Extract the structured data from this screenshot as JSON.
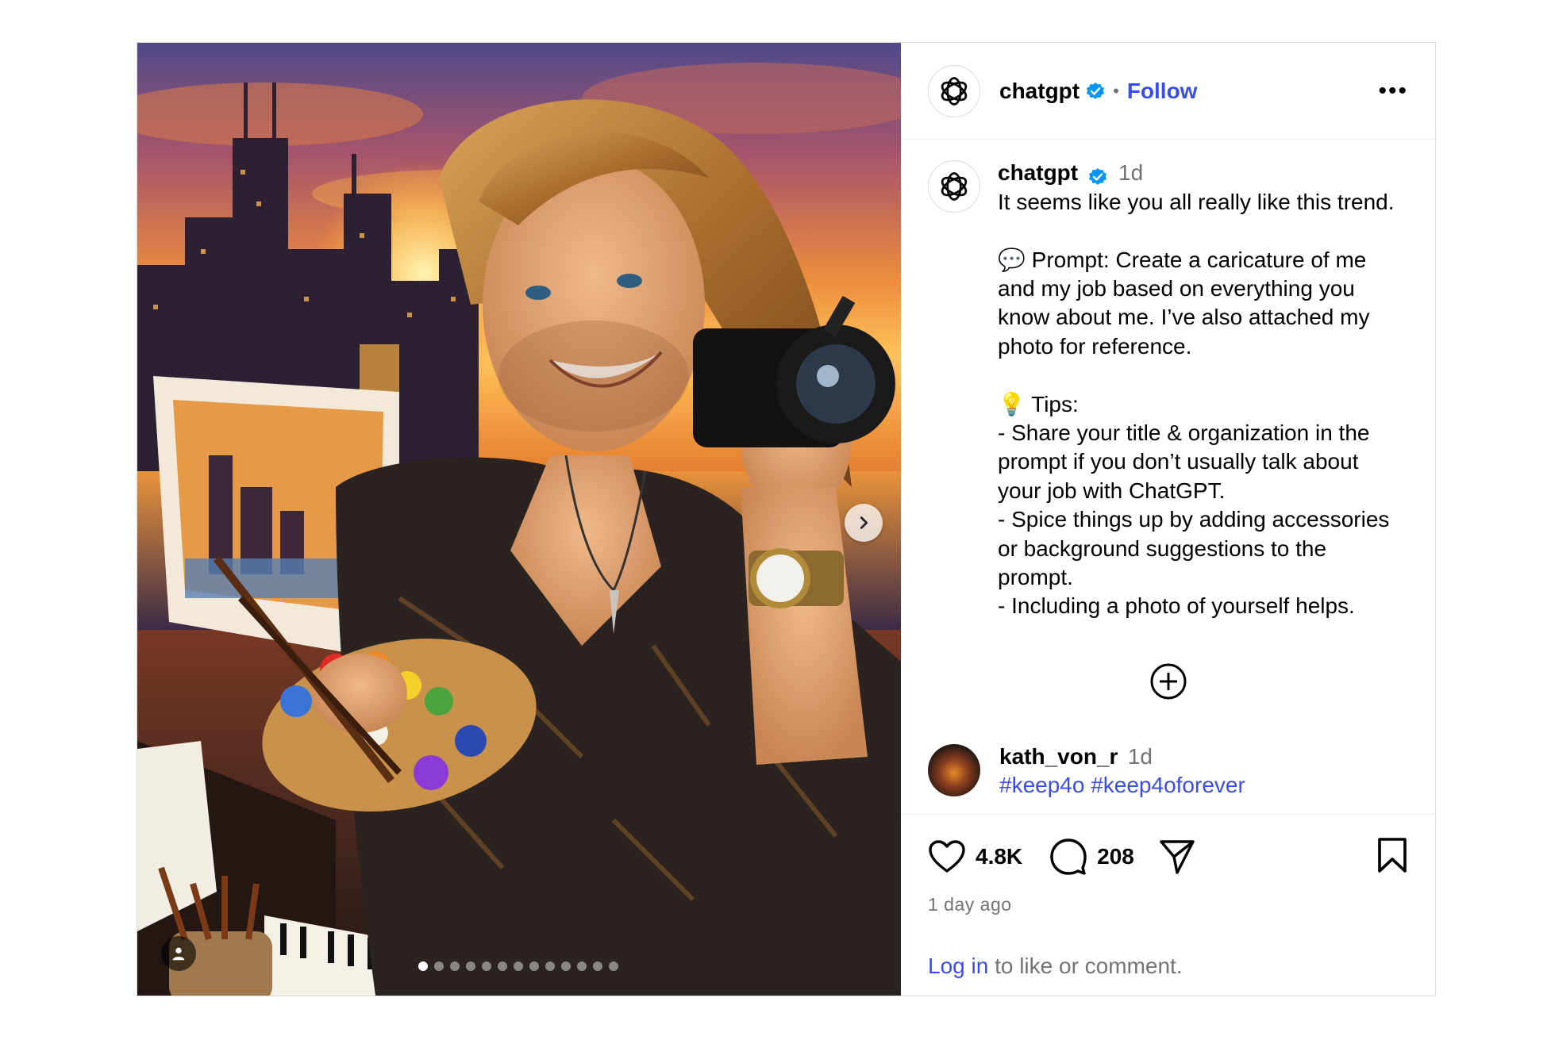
{
  "header": {
    "username": "chatgpt",
    "separator": "•",
    "follow_label": "Follow",
    "more_label": "•••"
  },
  "caption": {
    "username": "chatgpt",
    "time": "1d",
    "text": "It seems like you all really like this trend.\n\n💬 Prompt: Create a caricature of me\nand my job based on everything you\nknow about me. I’ve also attached my\nphoto for reference.\n\n💡 Tips:\n- Share your title & organization in the\nprompt if you don’t usually talk about\nyour job with ChatGPT.\n- Spice things up by adding accessories\nor background suggestions to the\nprompt.\n- Including a photo of yourself helps."
  },
  "comment": {
    "username": "kath_von_r",
    "time": "1d",
    "hashtag_1": "#keep4o",
    "hashtag_2": "#keep4oforever"
  },
  "actions": {
    "likes": "4.8K",
    "comments": "208"
  },
  "time_ago": "1 day ago",
  "login": {
    "link": "Log in",
    "rest": " to like or comment."
  },
  "carousel": {
    "total_slides": 13,
    "active_index": 0
  },
  "colors": {
    "link_blue": "#3a4de8",
    "verified_blue": "#0095f6",
    "muted_gray": "#737373",
    "border": "#dbdbdb"
  }
}
